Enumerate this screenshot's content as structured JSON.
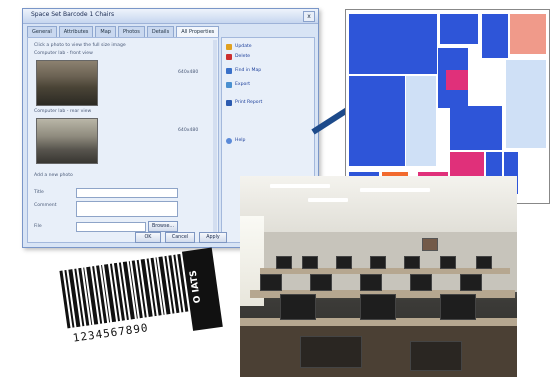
{
  "dialog": {
    "title": "Space Set Barcode 1 Chairs",
    "close_label": "x",
    "tabs": [
      "General",
      "Attributes",
      "Map",
      "Photos",
      "Details",
      "All Properties"
    ],
    "active_tab": 5,
    "info_lines": [
      "Click a photo to view the full size image"
    ],
    "photo_caption_1": "Computer lab - front view",
    "photo_caption_2": "Computer lab - rear view",
    "photo_size_1": "640x480",
    "photo_size_2": "640x480",
    "form_title": "Add a new photo",
    "form_labels": [
      "Title",
      "Comment",
      "File"
    ],
    "browse_label": "Browse...",
    "buttons": [
      "OK",
      "Cancel",
      "Apply"
    ],
    "right_links": [
      "Update",
      "Delete",
      "Find in Map",
      "Export",
      "Print Report",
      "Help"
    ]
  },
  "barcode": {
    "digits": "1234567890",
    "tag_text": "O IATS"
  },
  "colors": {
    "accent_blue": "#2e55d8",
    "accent_pink": "#e0307a",
    "dialog_bg": "#d8e4f5",
    "arrow": "#1d4a8a"
  },
  "icons": [
    "close-icon",
    "update-icon",
    "delete-icon",
    "map-icon",
    "export-icon",
    "print-icon",
    "help-icon",
    "arrow-icon"
  ]
}
